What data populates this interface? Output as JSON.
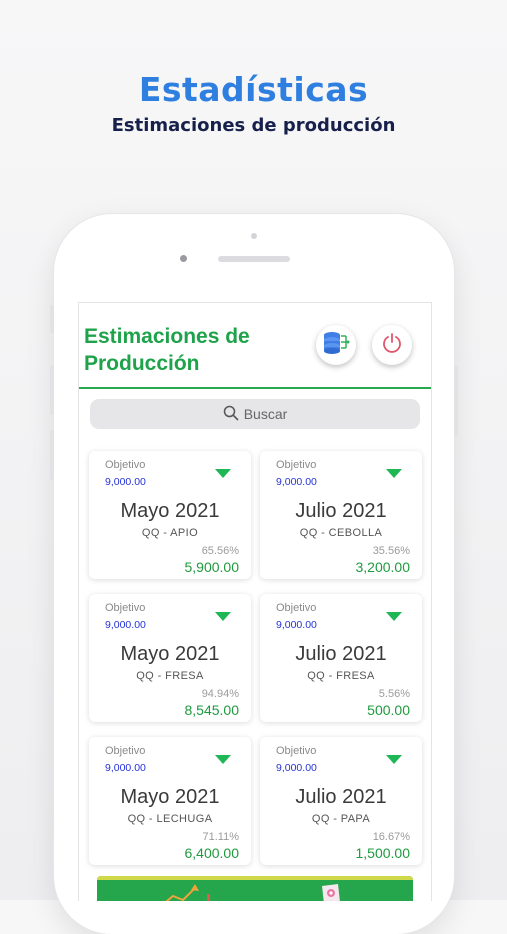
{
  "promo": {
    "title": "Estadísticas",
    "subtitle": "Estimaciones de producción"
  },
  "app": {
    "title_line1": "Estimaciones de",
    "title_line2": "Producción",
    "database_button_icon": "database-icon",
    "power_button_icon": "power-icon"
  },
  "search": {
    "placeholder": "Buscar",
    "icon": "search-icon"
  },
  "cards": [
    {
      "objective_label": "Objetivo",
      "objective_value": "9,000.00",
      "month": "Mayo 2021",
      "product": "QQ - APIO",
      "percent": "65.56%",
      "amount": "5,900.00"
    },
    {
      "objective_label": "Objetivo",
      "objective_value": "9,000.00",
      "month": "Julio 2021",
      "product": "QQ - CEBOLLA",
      "percent": "35.56%",
      "amount": "3,200.00"
    },
    {
      "objective_label": "Objetivo",
      "objective_value": "9,000.00",
      "month": "Mayo 2021",
      "product": "QQ - FRESA",
      "percent": "94.94%",
      "amount": "8,545.00"
    },
    {
      "objective_label": "Objetivo",
      "objective_value": "9,000.00",
      "month": "Julio 2021",
      "product": "QQ - FRESA",
      "percent": "5.56%",
      "amount": "500.00"
    },
    {
      "objective_label": "Objetivo",
      "objective_value": "9,000.00",
      "month": "Mayo 2021",
      "product": "QQ - LECHUGA",
      "percent": "71.11%",
      "amount": "6,400.00"
    },
    {
      "objective_label": "Objetivo",
      "objective_value": "9,000.00",
      "month": "Julio 2021",
      "product": "QQ - PAPA",
      "percent": "16.67%",
      "amount": "1,500.00"
    }
  ],
  "colors": {
    "brand_green": "#1fa34a",
    "promo_blue": "#2f7fe0",
    "objective_blue": "#2533d6",
    "trend_indicator": "#1fb655",
    "power_red": "#e0566a"
  }
}
